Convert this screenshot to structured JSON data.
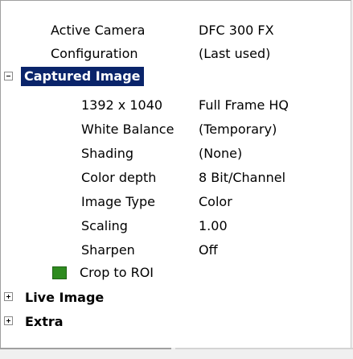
{
  "rows": [
    {
      "label": "Active Camera",
      "value": "DFC 300 FX"
    },
    {
      "label": "Configuration",
      "value": "(Last used)"
    }
  ],
  "sections": {
    "captured": {
      "label": "Captured Image",
      "expanded": true
    },
    "live": {
      "label": "Live Image",
      "expanded": false
    },
    "extra": {
      "label": "Extra",
      "expanded": false
    }
  },
  "captured_rows": [
    {
      "label": "1392 x 1040",
      "value": "Full Frame HQ"
    },
    {
      "label": "White Balance",
      "value": "(Temporary)"
    },
    {
      "label": "Shading",
      "value": "(None)"
    },
    {
      "label": "Color depth",
      "value": "8 Bit/Channel"
    },
    {
      "label": "Image Type",
      "value": "Color"
    },
    {
      "label": "Scaling",
      "value": "1.00"
    },
    {
      "label": "Sharpen",
      "value": "Off"
    }
  ],
  "crop": {
    "label": "Crop to ROI",
    "checked": true,
    "color": "#2e8b1f"
  }
}
